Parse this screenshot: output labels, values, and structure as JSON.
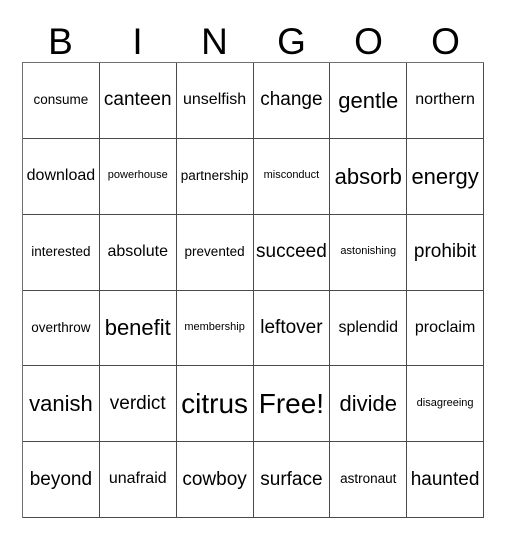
{
  "card": {
    "title_letters": [
      "B",
      "I",
      "N",
      "G",
      "O",
      "O"
    ],
    "columns": 6,
    "rows": 6,
    "border_color": "#4a4a4a",
    "background_color": "#ffffff",
    "text_color": "#000000",
    "free_space": "Free!",
    "free_space_position": {
      "row": 5,
      "column": 4
    }
  },
  "grid": {
    "rows": [
      {
        "cells": [
          {
            "text": "consume",
            "size": "s"
          },
          {
            "text": "canteen",
            "size": "l"
          },
          {
            "text": "unselfish",
            "size": "m"
          },
          {
            "text": "change",
            "size": "l"
          },
          {
            "text": "gentle",
            "size": "xl"
          },
          {
            "text": "northern",
            "size": "m"
          }
        ]
      },
      {
        "cells": [
          {
            "text": "download",
            "size": "m"
          },
          {
            "text": "powerhouse",
            "size": "xs"
          },
          {
            "text": "partnership",
            "size": "s"
          },
          {
            "text": "misconduct",
            "size": "xs"
          },
          {
            "text": "absorb",
            "size": "xl"
          },
          {
            "text": "energy",
            "size": "xl"
          }
        ]
      },
      {
        "cells": [
          {
            "text": "interested",
            "size": "s"
          },
          {
            "text": "absolute",
            "size": "m"
          },
          {
            "text": "prevented",
            "size": "s"
          },
          {
            "text": "succeed",
            "size": "l"
          },
          {
            "text": "astonishing",
            "size": "xs"
          },
          {
            "text": "prohibit",
            "size": "l"
          }
        ]
      },
      {
        "cells": [
          {
            "text": "overthrow",
            "size": "s"
          },
          {
            "text": "benefit",
            "size": "xl"
          },
          {
            "text": "membership",
            "size": "xs"
          },
          {
            "text": "leftover",
            "size": "l"
          },
          {
            "text": "splendid",
            "size": "m"
          },
          {
            "text": "proclaim",
            "size": "m"
          }
        ]
      },
      {
        "cells": [
          {
            "text": "vanish",
            "size": "xl"
          },
          {
            "text": "verdict",
            "size": "l"
          },
          {
            "text": "citrus",
            "size": "xxl"
          },
          {
            "text": "Free!",
            "size": "xxl"
          },
          {
            "text": "divide",
            "size": "xl"
          },
          {
            "text": "disagreeing",
            "size": "xs"
          }
        ]
      },
      {
        "cells": [
          {
            "text": "beyond",
            "size": "l"
          },
          {
            "text": "unafraid",
            "size": "m"
          },
          {
            "text": "cowboy",
            "size": "l"
          },
          {
            "text": "surface",
            "size": "l"
          },
          {
            "text": "astronaut",
            "size": "s"
          },
          {
            "text": "haunted",
            "size": "l"
          }
        ]
      }
    ]
  }
}
